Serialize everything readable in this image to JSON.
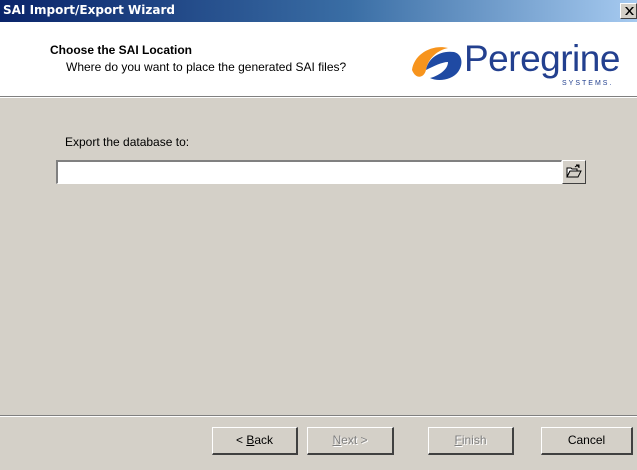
{
  "window": {
    "title": "SAI Import/Export Wizard"
  },
  "header": {
    "title": "Choose the SAI Location",
    "subtitle": "Where do you want to place the generated SAI files?",
    "logo_word": "Peregrine",
    "logo_sub": "SYSTEMS.",
    "logo_color": "#23408f",
    "logo_mark_colors": [
      "#f7941d",
      "#1f4aa3"
    ]
  },
  "form": {
    "export_label": "Export the database to:",
    "export_value": "",
    "browse_icon": "folder-open-icon"
  },
  "buttons": {
    "back": {
      "mnemonic": "B",
      "rest": "ack",
      "prefix": "< ",
      "enabled": true
    },
    "next": {
      "mnemonic": "N",
      "rest": "ext",
      "suffix": " >",
      "enabled": false
    },
    "finish": {
      "mnemonic": "F",
      "rest": "inish",
      "enabled": false
    },
    "cancel": {
      "label": "Cancel",
      "enabled": true
    }
  },
  "colors": {
    "titlebar_start": "#0a246a",
    "titlebar_end": "#a6caf0",
    "dialog_face": "#d4d0c8"
  }
}
